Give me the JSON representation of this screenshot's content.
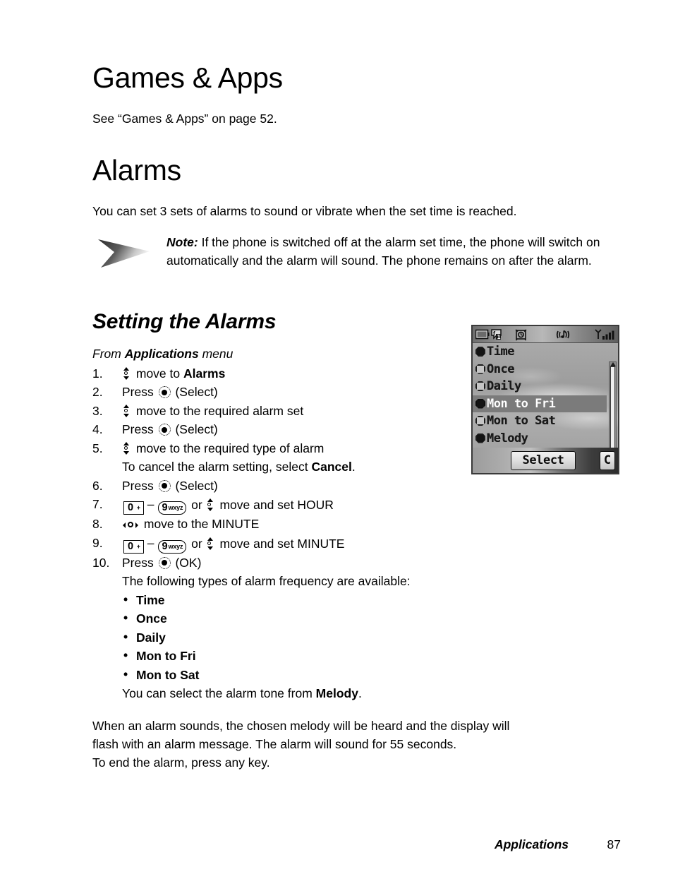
{
  "headings": {
    "games_apps": "Games & Apps",
    "alarms": "Alarms",
    "setting_the_alarms": "Setting the Alarms"
  },
  "paragraphs": {
    "see_reference": "See “Games & Apps” on page 52.",
    "alarms_intro": "You can set 3 sets of alarms to sound or vibrate when the set time is reached.",
    "closing_line1": "When an alarm sounds, the chosen melody will be heard and the display will",
    "closing_line2": "flash with an alarm message. The alarm will sound for 55 seconds.",
    "closing_line3": "To end the alarm, press any key."
  },
  "note": {
    "label": "Note:",
    "text": "If the phone is switched off at the alarm set time, the phone will switch on automatically and the alarm will sound. The phone remains on after the alarm."
  },
  "procedure": {
    "from_prefix": "From ",
    "from_bold": "Applications",
    "from_suffix": " menu",
    "steps": [
      {
        "num": "1.",
        "pre": "",
        "icon": "nav-up-down",
        "text": " move to ",
        "bold": "Alarms",
        "post": ""
      },
      {
        "num": "2.",
        "pre": "Press ",
        "icon": "select-key",
        "text": " (Select)",
        "bold": "",
        "post": ""
      },
      {
        "num": "3.",
        "pre": "",
        "icon": "nav-up-down",
        "text": " move to the required alarm set",
        "bold": "",
        "post": ""
      },
      {
        "num": "4.",
        "pre": "Press ",
        "icon": "select-key",
        "text": " (Select)",
        "bold": "",
        "post": ""
      },
      {
        "num": "5.",
        "pre": "",
        "icon": "nav-up-down",
        "text": " move to the required type of alarm",
        "bold": "",
        "post": ""
      },
      {
        "num": "6.",
        "pre": "Press ",
        "icon": "select-key",
        "text": " (Select)",
        "bold": "",
        "post": ""
      },
      {
        "num": "7.",
        "pre": "",
        "icon": "key-range",
        "text": " or ",
        "bold": "",
        "post": " move and set HOUR"
      },
      {
        "num": "8.",
        "pre": "",
        "icon": "nav-left-right",
        "text": " move to the MINUTE",
        "bold": "",
        "post": ""
      },
      {
        "num": "9.",
        "pre": "",
        "icon": "key-range",
        "text": " or ",
        "bold": "",
        "post": " move and set MINUTE"
      },
      {
        "num": "10.",
        "pre": "Press ",
        "icon": "select-key",
        "text": " (OK)",
        "bold": "",
        "post": ""
      }
    ],
    "step5_sub_pre": "To cancel the alarm setting, select ",
    "step5_sub_bold": "Cancel",
    "step5_sub_post": ".",
    "step10_sub": "The following types of alarm frequency are available:",
    "alarm_types": [
      "Time",
      "Once",
      "Daily",
      "Mon to Fri",
      "Mon to Sat"
    ],
    "melody_pre": "You can select the alarm tone from ",
    "melody_bold": "Melody",
    "melody_post": "."
  },
  "keys": {
    "zero_digit": "0",
    "zero_symbol": "+",
    "nine_digit": "9",
    "nine_letters": "wxyz",
    "dash": "–"
  },
  "phone_screen": {
    "status_icons": [
      "battery-icon",
      "messages-1-icon",
      "alarm-clock-icon",
      "melody-note-icon",
      "signal-bars-icon"
    ],
    "list_items": [
      {
        "label": "Time",
        "selected_radio": true,
        "highlighted": false
      },
      {
        "label": "Once",
        "selected_radio": false,
        "highlighted": false
      },
      {
        "label": "Daily",
        "selected_radio": false,
        "highlighted": false
      },
      {
        "label": "Mon to Fri",
        "selected_radio": true,
        "highlighted": true
      },
      {
        "label": "Mon to Sat",
        "selected_radio": false,
        "highlighted": false
      },
      {
        "label": "Melody",
        "selected_radio": true,
        "highlighted": false
      }
    ],
    "softkey_left": "Select",
    "softkey_right": "C"
  },
  "footer": {
    "section": "Applications",
    "page_number": "87"
  },
  "colors": {
    "text": "#000000",
    "page_background": "#ffffff",
    "phone_screen_background": "#a9a9a9",
    "phone_highlight": "#7b7b7b",
    "phone_border": "#3a3a3a"
  }
}
